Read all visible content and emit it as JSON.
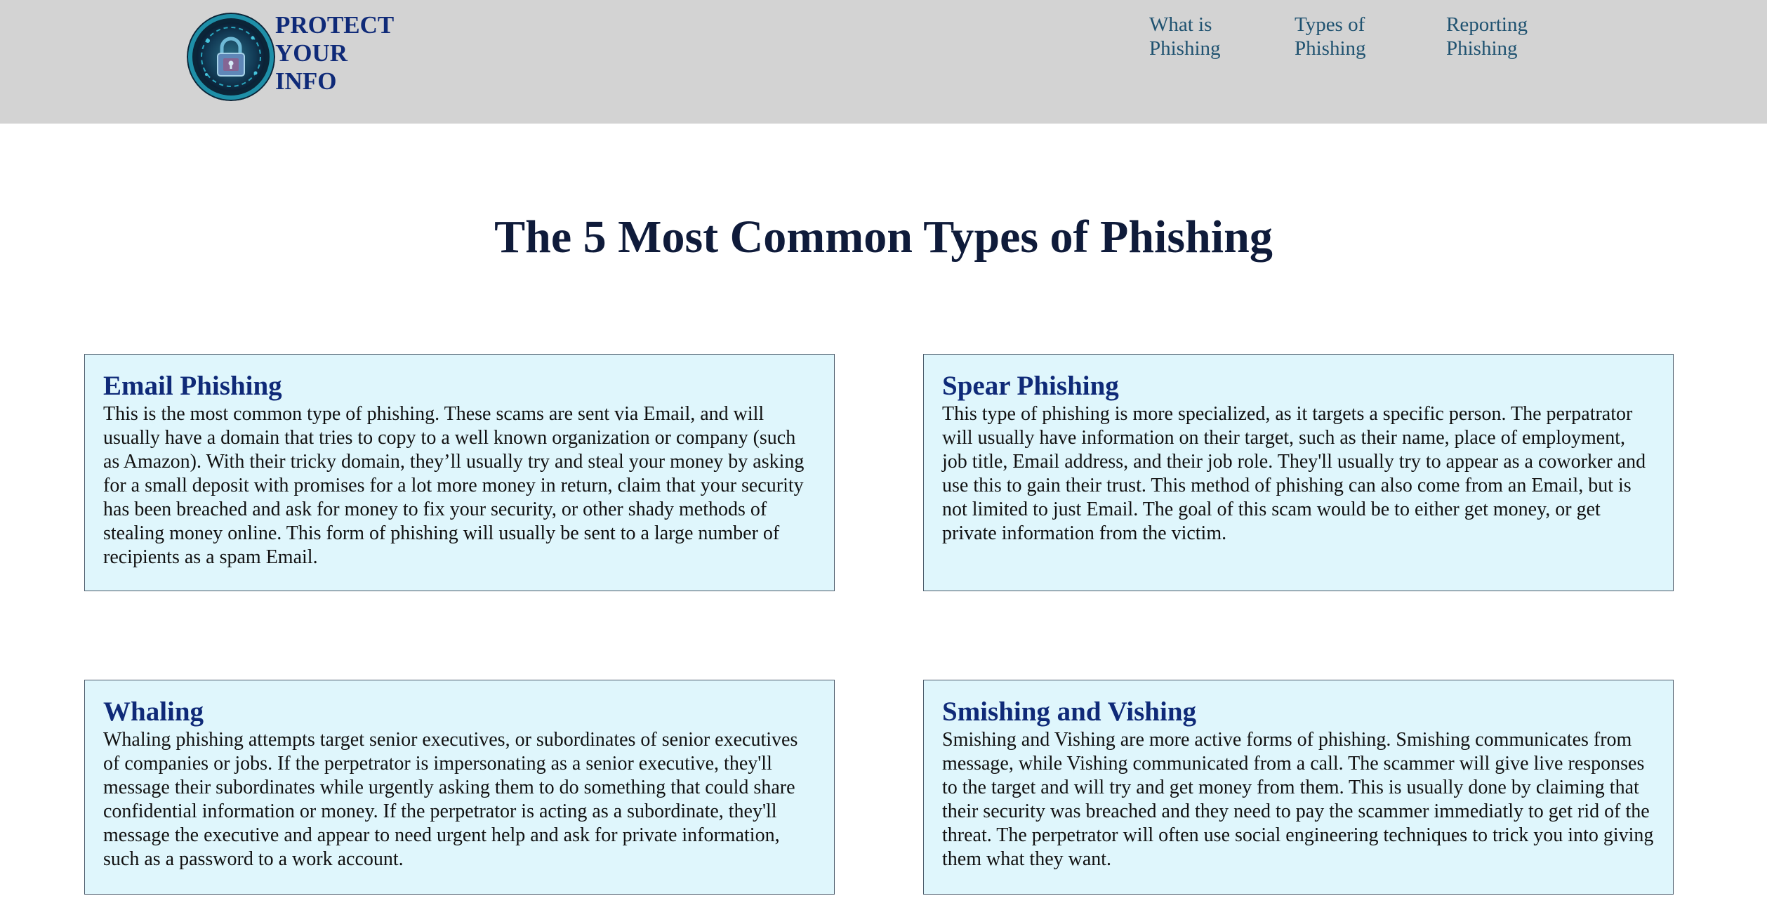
{
  "header": {
    "brand_lines": [
      "PROTECT",
      "YOUR",
      "INFO"
    ],
    "logo_icon": "padlock-icon",
    "nav": [
      {
        "label": "What is\nPhishing"
      },
      {
        "label": "Types of\nPhishing"
      },
      {
        "label": "Reporting\nPhishing"
      }
    ]
  },
  "main": {
    "title": "The 5 Most Common Types of Phishing",
    "cards": [
      {
        "title": "Email Phishing",
        "text": "This is the most common type of phishing. These scams are sent via Email, and will usually have a domain that tries to copy to a well known organization or company (such as Amazon). With their tricky domain, they’ll usually try and steal your money by asking for a small deposit with promises for a lot more money in return, claim that your security has been breached and ask for money to fix your security, or other shady methods of stealing money online. This form of phishing will usually be sent to a large number of recipients as a spam Email."
      },
      {
        "title": "Spear Phishing",
        "text": "This type of phishing is more specialized, as it targets a specific person. The perpatrator will usually have information on their target, such as their name, place of employment, job title, Email address, and their job role. They'll usually try to appear as a coworker and use this to gain their trust. This method of phishing can also come from an Email, but is not limited to just Email. The goal of this scam would be to either get money, or get private information from the victim."
      },
      {
        "title": "Whaling",
        "text": "Whaling phishing attempts target senior executives, or subordinates of senior executives of companies or jobs. If the perpetrator is impersonating as a senior executive, they'll message their subordinates while urgently asking them to do something that could share confidential information or money. If the perpetrator is acting as a subordinate, they'll message the executive and appear to need urgent help and ask for private information, such as a password to a work account."
      },
      {
        "title": "Smishing and Vishing",
        "text": "Smishing and Vishing are more active forms of phishing. Smishing communicates from message, while Vishing communicated from a call. The scammer will give live responses to the target and will try and get money from them. This is usually done by claiming that their security was breached and they need to pay the scammer immediatly to get rid of the threat. The perpetrator will often use social engineering techniques to trick you into giving them what they want."
      }
    ]
  },
  "colors": {
    "header_bg": "#d3d3d3",
    "brand": "#0f2a78",
    "nav_link": "#1f5270",
    "title": "#0f1b3a",
    "card_bg": "#dff6fc",
    "card_border": "#4a5a6a"
  }
}
